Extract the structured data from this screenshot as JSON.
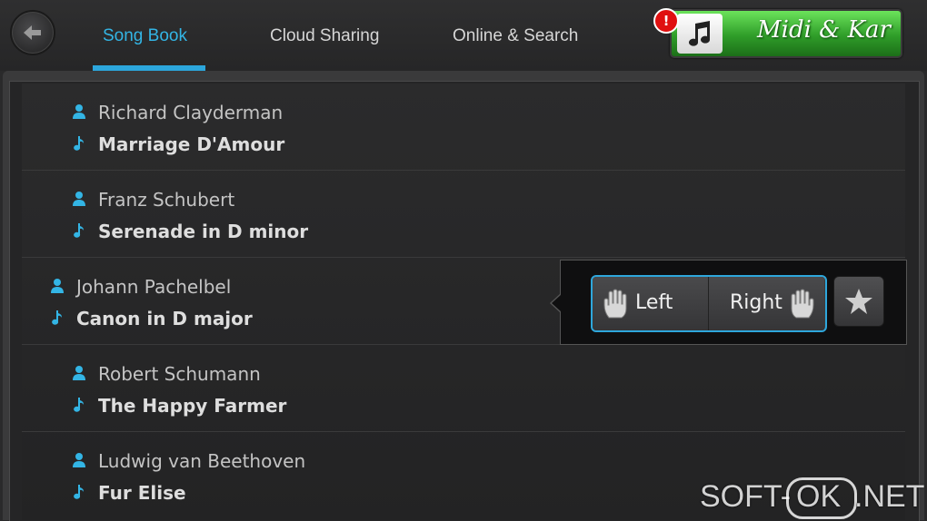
{
  "header": {
    "tabs": [
      {
        "label": "Song Book",
        "active": true
      },
      {
        "label": "Cloud Sharing",
        "active": false
      },
      {
        "label": "Online & Search",
        "active": false
      }
    ],
    "promo": {
      "text": "Midi & Kar",
      "badge": "!"
    }
  },
  "songs": [
    {
      "composer": "Richard Clayderman",
      "title": "Marriage D'Amour"
    },
    {
      "composer": "Franz Schubert",
      "title": "Serenade in D minor"
    },
    {
      "composer": "Johann Pachelbel",
      "title": "Canon in D major"
    },
    {
      "composer": "Robert Schumann",
      "title": "The Happy Farmer"
    },
    {
      "composer": "Ludwig van Beethoven",
      "title": "Fur Elise"
    }
  ],
  "popup": {
    "left_label": "Left",
    "right_label": "Right"
  },
  "watermark": {
    "left": "SOFT-",
    "middle": "OK",
    "right": ".NET"
  },
  "colors": {
    "accent": "#33b5e5",
    "background": "#2a2a2b",
    "promo": "#3fbf34"
  },
  "icons": {
    "back": "back-arrow-icon",
    "person": "person-icon",
    "note": "music-note-icon",
    "hand": "hand-icon",
    "star": "star-icon"
  }
}
